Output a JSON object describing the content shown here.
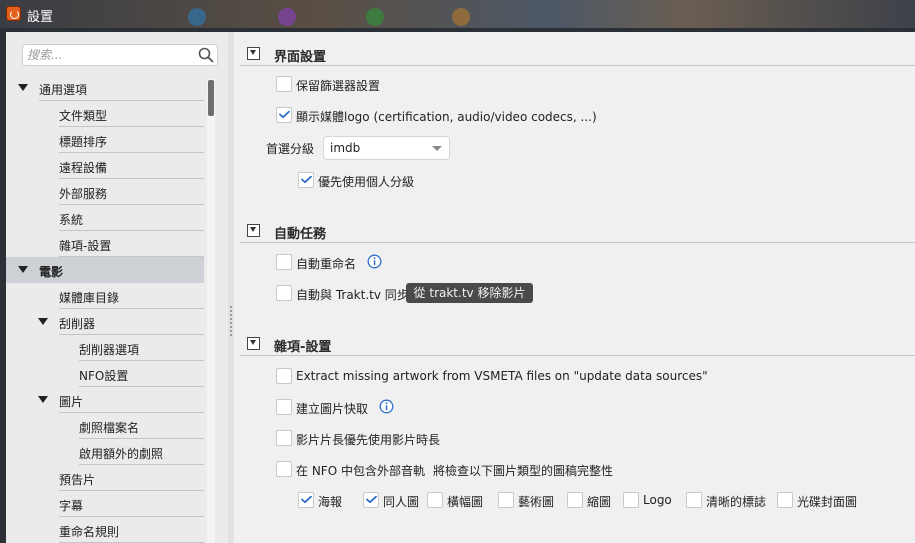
{
  "window": {
    "title": "設置"
  },
  "search": {
    "placeholder": "搜索..."
  },
  "sidebar": {
    "items": [
      {
        "label": "通用選項",
        "level": 0,
        "expanded": true
      },
      {
        "label": "文件類型",
        "level": 1
      },
      {
        "label": "標題排序",
        "level": 1
      },
      {
        "label": "遠程設備",
        "level": 1
      },
      {
        "label": "外部服務",
        "level": 1
      },
      {
        "label": "系統",
        "level": 1
      },
      {
        "label": "雜項-設置",
        "level": 1
      },
      {
        "label": "電影",
        "level": 0,
        "expanded": true,
        "selected": true
      },
      {
        "label": "媒體庫目錄",
        "level": 1
      },
      {
        "label": "刮削器",
        "level": 1,
        "expanded": true
      },
      {
        "label": "刮削器選項",
        "level": 2
      },
      {
        "label": "NFO設置",
        "level": 2
      },
      {
        "label": "圖片",
        "level": 1,
        "expanded": true
      },
      {
        "label": "劇照檔案名",
        "level": 2
      },
      {
        "label": "啟用額外的劇照",
        "level": 2
      },
      {
        "label": "預告片",
        "level": 1
      },
      {
        "label": "字幕",
        "level": 1
      },
      {
        "label": "重命名規則",
        "level": 1
      }
    ]
  },
  "ui_section": {
    "title": "界面設置",
    "keep_filter": {
      "label": "保留篩選器設置",
      "checked": false
    },
    "show_logo": {
      "label": "顯示媒體logo (certification, audio/video codecs, ...)",
      "checked": true
    },
    "rating_label": "首選分級",
    "rating_value": "imdb",
    "personal_rating": {
      "label": "優先使用個人分級",
      "checked": true
    }
  },
  "auto_section": {
    "title": "自動任務",
    "auto_rename": {
      "label": "自動重命名",
      "checked": false
    },
    "trakt_sync": {
      "label": "自動與 Trakt.tv 同步",
      "checked": false
    },
    "trakt_remove_button": "從 trakt.tv 移除影片"
  },
  "misc_section": {
    "title": "雜項-設置",
    "vsmeta": {
      "label": "Extract missing artwork from VSMETA files on \"update data sources\"",
      "checked": false
    },
    "image_cache": {
      "label": "建立圖片快取",
      "checked": false
    },
    "runtime": {
      "label": "影片片長優先使用影片時長",
      "checked": false
    },
    "nfo_audio": {
      "label": "在 NFO 中包含外部音軌",
      "checked": false
    },
    "artwork_check_label": "將檢查以下圖片類型的圖稿完整性",
    "artwork_types": [
      {
        "label": "海報",
        "checked": true
      },
      {
        "label": "同人圖",
        "checked": true
      },
      {
        "label": "橫幅圖",
        "checked": false
      },
      {
        "label": "藝術圖",
        "checked": false
      },
      {
        "label": "縮圖",
        "checked": false
      },
      {
        "label": "Logo",
        "checked": false
      },
      {
        "label": "清晰的標誌",
        "checked": false
      },
      {
        "label": "光碟封面圖",
        "checked": false
      }
    ]
  },
  "colors": {
    "accent": "#2f6fc9",
    "selected_row": "#cdd1d6",
    "button_dark": "#4a4a4a"
  }
}
